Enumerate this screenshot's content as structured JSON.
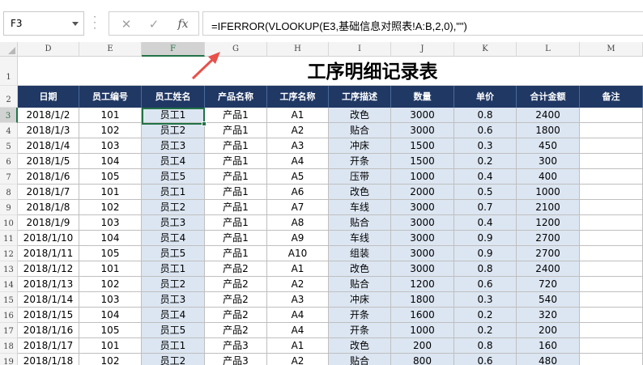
{
  "name_box": "F3",
  "formula": "=IFERROR(VLOOKUP(E3,基础信息对照表!A:B,2,0),\"\")",
  "formula_buttons": {
    "cancel": "✕",
    "enter": "✓",
    "fx": "fx"
  },
  "columns": [
    "D",
    "E",
    "F",
    "G",
    "H",
    "I",
    "J",
    "K",
    "L",
    "M"
  ],
  "selected_column": "F",
  "row_numbers": [
    "1",
    "2",
    "3",
    "4",
    "5",
    "6",
    "7",
    "8",
    "9",
    "10",
    "11",
    "12",
    "13",
    "14",
    "15",
    "16",
    "17",
    "18",
    "19"
  ],
  "selected_row": "3",
  "sheet_title": "工序明细记录表",
  "headers": [
    "日期",
    "员工编号",
    "员工姓名",
    "产品名称",
    "工序名称",
    "工序描述",
    "数量",
    "单价",
    "合计金额",
    "备注"
  ],
  "rows": [
    [
      "2018/1/2",
      "101",
      "员工1",
      "产品1",
      "A1",
      "改色",
      "3000",
      "0.8",
      "2400",
      ""
    ],
    [
      "2018/1/3",
      "102",
      "员工2",
      "产品1",
      "A2",
      "贴合",
      "3000",
      "0.6",
      "1800",
      ""
    ],
    [
      "2018/1/4",
      "103",
      "员工3",
      "产品1",
      "A3",
      "冲床",
      "1500",
      "0.3",
      "450",
      ""
    ],
    [
      "2018/1/5",
      "104",
      "员工4",
      "产品1",
      "A4",
      "开条",
      "1500",
      "0.2",
      "300",
      ""
    ],
    [
      "2018/1/6",
      "105",
      "员工5",
      "产品1",
      "A5",
      "压带",
      "1000",
      "0.4",
      "400",
      ""
    ],
    [
      "2018/1/7",
      "101",
      "员工1",
      "产品1",
      "A6",
      "改色",
      "2000",
      "0.5",
      "1000",
      ""
    ],
    [
      "2018/1/8",
      "102",
      "员工2",
      "产品1",
      "A7",
      "车线",
      "3000",
      "0.7",
      "2100",
      ""
    ],
    [
      "2018/1/9",
      "103",
      "员工3",
      "产品1",
      "A8",
      "贴合",
      "3000",
      "0.4",
      "1200",
      ""
    ],
    [
      "2018/1/10",
      "104",
      "员工4",
      "产品1",
      "A9",
      "车线",
      "3000",
      "0.9",
      "2700",
      ""
    ],
    [
      "2018/1/11",
      "105",
      "员工5",
      "产品1",
      "A10",
      "组装",
      "3000",
      "0.9",
      "2700",
      ""
    ],
    [
      "2018/1/12",
      "101",
      "员工1",
      "产品2",
      "A1",
      "改色",
      "3000",
      "0.8",
      "2400",
      ""
    ],
    [
      "2018/1/13",
      "102",
      "员工2",
      "产品2",
      "A2",
      "贴合",
      "1200",
      "0.6",
      "720",
      ""
    ],
    [
      "2018/1/14",
      "103",
      "员工3",
      "产品2",
      "A3",
      "冲床",
      "1800",
      "0.3",
      "540",
      ""
    ],
    [
      "2018/1/15",
      "104",
      "员工4",
      "产品2",
      "A4",
      "开条",
      "1600",
      "0.2",
      "320",
      ""
    ],
    [
      "2018/1/16",
      "105",
      "员工5",
      "产品2",
      "A4",
      "开条",
      "1000",
      "0.2",
      "200",
      ""
    ],
    [
      "2018/1/17",
      "101",
      "员工1",
      "产品3",
      "A1",
      "改色",
      "200",
      "0.8",
      "160",
      ""
    ],
    [
      "2018/1/18",
      "102",
      "员工2",
      "产品3",
      "A2",
      "贴合",
      "800",
      "0.6",
      "480",
      ""
    ]
  ],
  "colors": {
    "header_bg": "#203864",
    "header_text": "#ffffff",
    "highlight_column_bg": "#dce6f2",
    "selection": "#217346",
    "arrow": "#e8504a"
  },
  "highlighted_columns": [
    "F",
    "I",
    "J",
    "K",
    "L"
  ]
}
